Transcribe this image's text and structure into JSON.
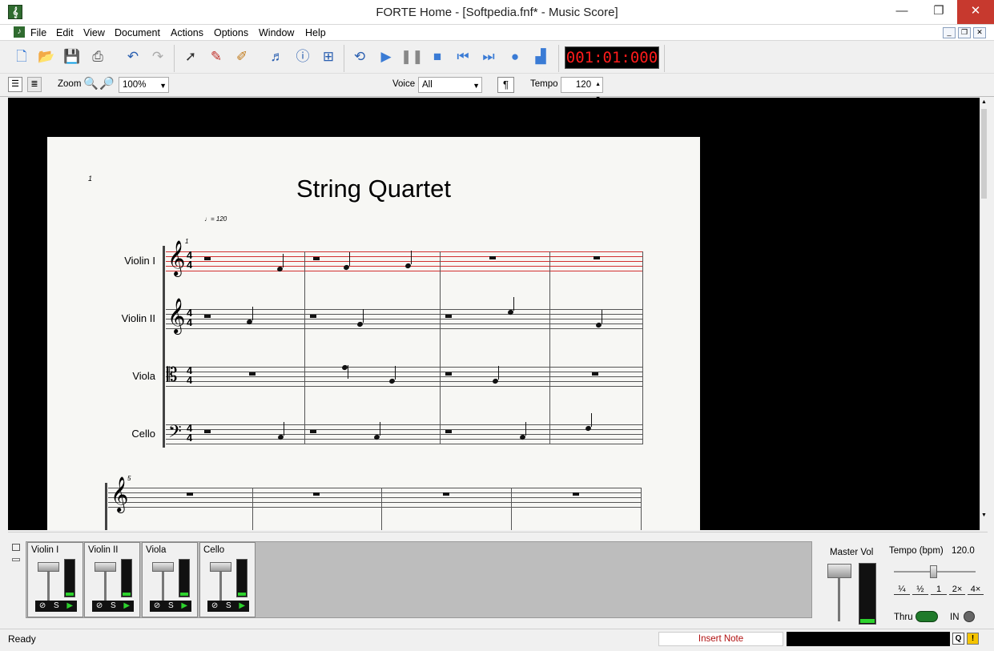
{
  "window": {
    "title": "FORTE Home - [Softpedia.fnf* - Music Score]",
    "app_icon": "treble-clef-icon"
  },
  "menu": [
    "File",
    "Edit",
    "View",
    "Document",
    "Actions",
    "Options",
    "Window",
    "Help"
  ],
  "toolbar": {
    "time": "001:01:000"
  },
  "toolbar2": {
    "zoom_label": "Zoom",
    "zoom_value": "100%",
    "voice_label": "Voice",
    "voice_value": "All",
    "pilcrow": "¶",
    "tempo_label": "Tempo",
    "tempo_value": "120"
  },
  "score": {
    "page_number": "1",
    "title": "String Quartet",
    "tempo_mark": "= 120",
    "measure_start_1": "1",
    "measure_start_2": "5",
    "staves": [
      "Violin I",
      "Violin II",
      "Viola",
      "Cello"
    ]
  },
  "mixer": {
    "channels": [
      "Violin I",
      "Violin II",
      "Viola",
      "Cello"
    ],
    "solo_label": "S",
    "master_vol_label": "Master Vol",
    "tempo_bpm_label": "Tempo (bpm)",
    "tempo_bpm_value": "120.0",
    "speed_buttons": [
      "¼",
      "½",
      "1",
      "2×",
      "4×"
    ],
    "thru_label": "Thru",
    "in_label": "IN"
  },
  "status": {
    "left": "Ready",
    "mode": "Insert Note"
  }
}
